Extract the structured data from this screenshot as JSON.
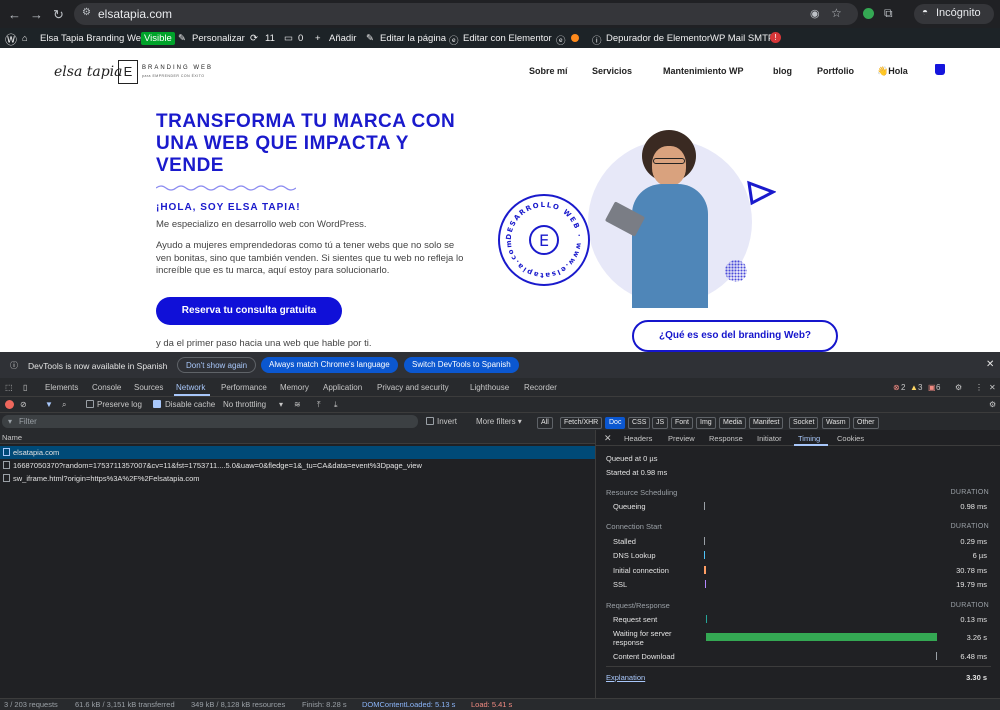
{
  "browser": {
    "url": "elsatapia.com",
    "incognito_label": "Incógnito"
  },
  "wpbar": {
    "site_name": "Elsa Tapia Branding Web",
    "visible_badge": "Visible",
    "customize": "Personalizar",
    "updates": "11",
    "comments": "0",
    "add_new": "Añadir",
    "edit_page": "Editar la página",
    "edit_elementor": "Editar con Elementor",
    "debugger": "Depurador de Elementor",
    "smtp": "WP Mail SMTP",
    "smtp_badge": "!"
  },
  "site": {
    "logo_script": "elsa tapia",
    "logo_letter": "E",
    "logo_sub": "BRANDING WEB",
    "logo_tag": "para EMPRENDER CON ÉXITO",
    "nav": [
      "Sobre mí",
      "Servicios",
      "Mantenimiento WP",
      "blog",
      "Portfolio",
      "👋Hola"
    ],
    "hero_title": "TRANSFORMA TU MARCA CON UNA WEB QUE IMPACTA Y VENDE",
    "greeting": "¡HOLA, SOY ELSA TAPIA!",
    "intro": "Me especializo en desarrollo web con WordPress.",
    "body": "Ayudo a mujeres emprendedoras como tú a tener webs que no solo se ven bonitas, sino que también venden. Si sientes que tu web no refleja lo increíble que es tu marca, aquí estoy para solucionarlo.",
    "cta": "Reserva tu consulta gratuita",
    "footer_line": "y da el primer paso hacia una web que hable por ti.",
    "cta2": "¿Qué es eso del branding Web?",
    "stamp_text": "DESARROLLO WEB · www.elsatapia.com ·",
    "accent": "#1a1acc"
  },
  "devtools": {
    "banner": {
      "text": "DevTools is now available in Spanish",
      "dont_show": "Don't show again",
      "match": "Always match Chrome's language",
      "switch": "Switch DevTools to Spanish"
    },
    "tabs": [
      "Elements",
      "Console",
      "Sources",
      "Network",
      "Performance",
      "Memory",
      "Application",
      "Privacy and security",
      "Lighthouse",
      "Recorder"
    ],
    "active_tab": "Network",
    "badges": {
      "errors": "2",
      "warnings": "3",
      "issues": "6"
    },
    "toolbar": {
      "preserve_log": "Preserve log",
      "disable_cache": "Disable cache",
      "throttling": "No throttling"
    },
    "filter": {
      "placeholder": "Filter",
      "invert": "Invert",
      "more_filters": "More filters ▾",
      "types": [
        "All",
        "Fetch/XHR",
        "Doc",
        "CSS",
        "JS",
        "Font",
        "Img",
        "Media",
        "Manifest",
        "Socket",
        "Wasm",
        "Other"
      ],
      "active_type": "Doc"
    },
    "name_header": "Name",
    "requests": [
      "elsatapia.com",
      "16687050370?random=1753711357007&cv=11&fst=1753711....5.0&uaw=0&fledge=1&_tu=CA&data=event%3Dpage_view",
      "sw_iframe.html?origin=https%3A%2F%2Felsatapia.com"
    ],
    "detail_tabs": [
      "Headers",
      "Preview",
      "Response",
      "Initiator",
      "Timing",
      "Cookies"
    ],
    "active_detail_tab": "Timing",
    "timing": {
      "queued": "Queued at 0 µs",
      "started": "Started at 0.98 ms",
      "duration_label": "DURATION",
      "sections": [
        {
          "title": "Resource Scheduling",
          "rows": [
            {
              "label": "Queueing",
              "value": "0.98 ms"
            }
          ]
        },
        {
          "title": "Connection Start",
          "rows": [
            {
              "label": "Stalled",
              "value": "0.29 ms"
            },
            {
              "label": "DNS Lookup",
              "value": "6 µs"
            },
            {
              "label": "Initial connection",
              "value": "30.78 ms"
            },
            {
              "label": "SSL",
              "value": "19.79 ms"
            }
          ]
        },
        {
          "title": "Request/Response",
          "rows": [
            {
              "label": "Request sent",
              "value": "0.13 ms"
            },
            {
              "label": "Waiting for server response",
              "value": "3.26 s"
            },
            {
              "label": "Content Download",
              "value": "6.48 ms"
            }
          ]
        }
      ],
      "explanation": "Explanation",
      "total": "3.30 s"
    },
    "status": {
      "requests": "3 / 203 requests",
      "transferred": "61.6 kB / 3,151 kB transferred",
      "resources": "349 kB / 8,128 kB resources",
      "finish": "Finish: 8.28 s",
      "dcl": "DOMContentLoaded: 5.13 s",
      "load": "Load: 5.41 s"
    }
  }
}
